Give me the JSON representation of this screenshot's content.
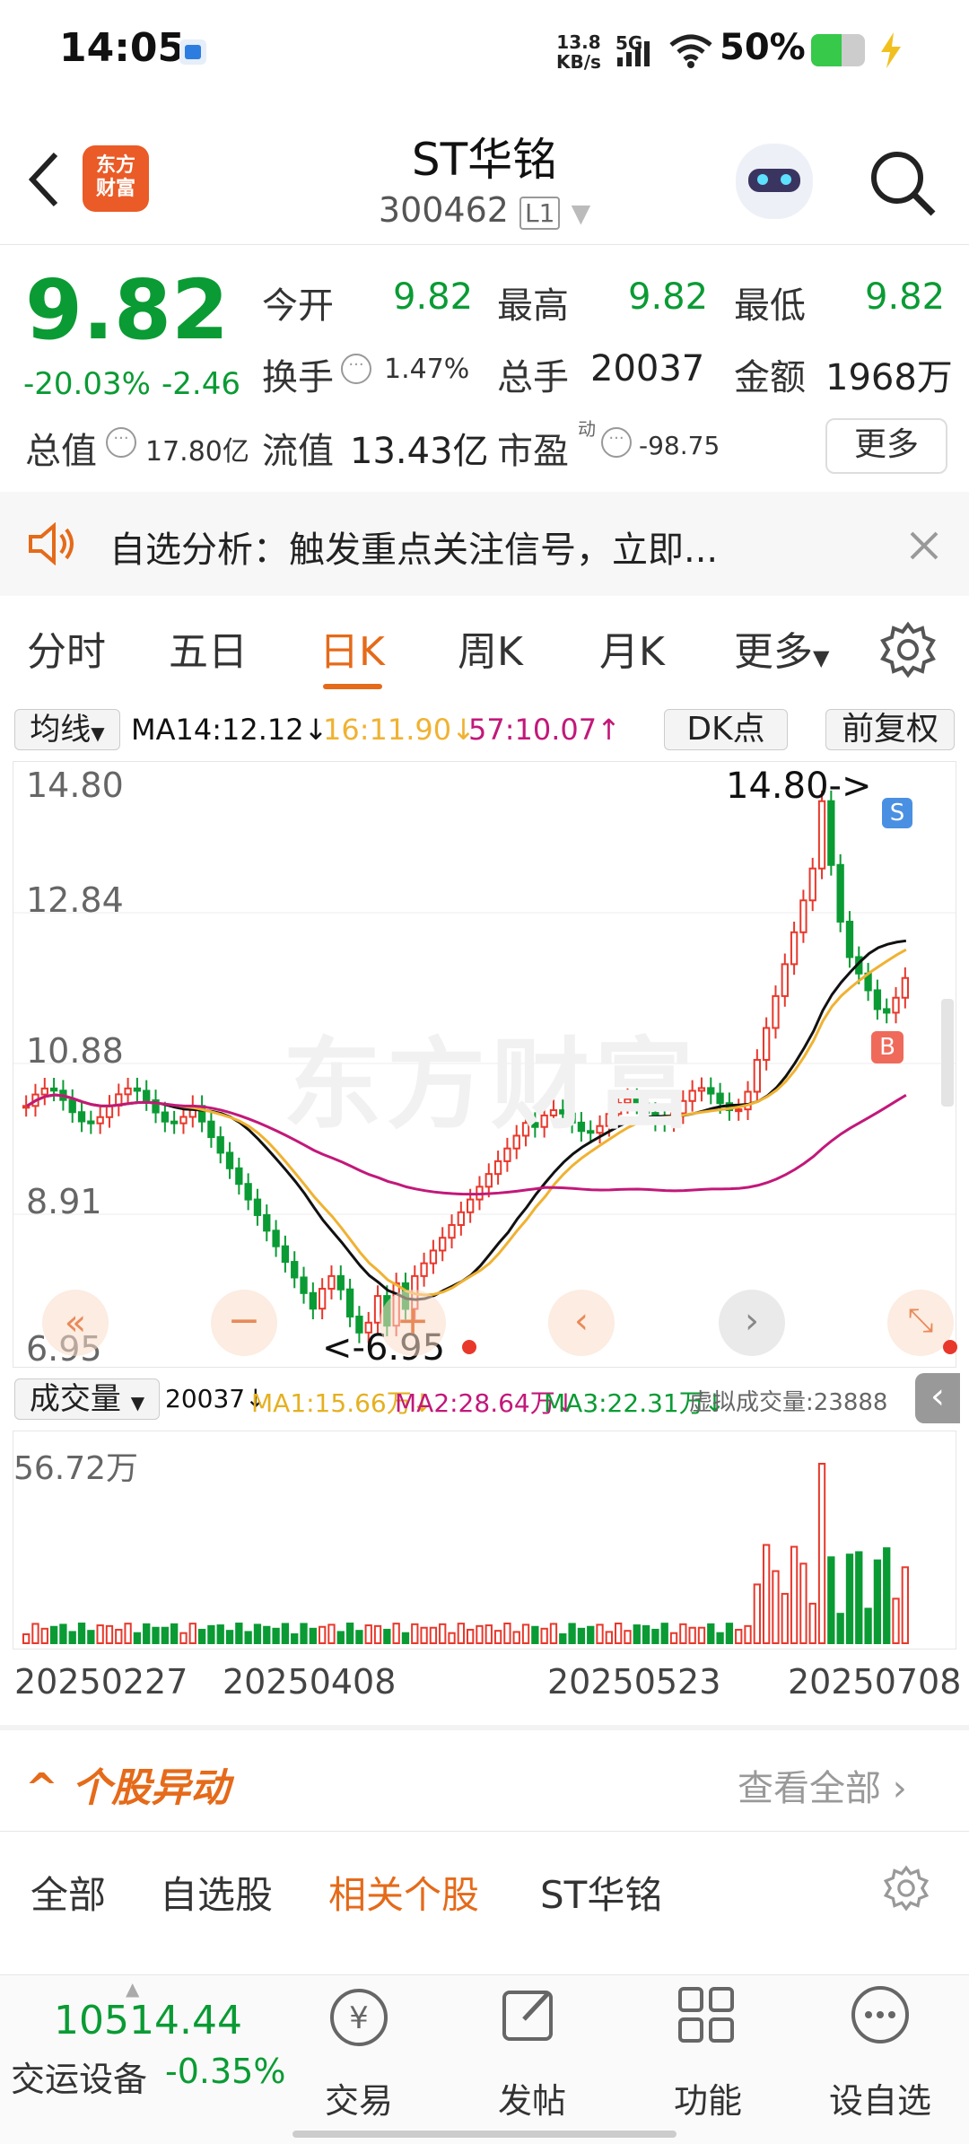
{
  "status_bar": {
    "time": "14:05",
    "net_speed_top": "13.8",
    "net_speed_bottom": "KB/s",
    "signal": "5G",
    "battery": "50%"
  },
  "header": {
    "title": "ST华铭",
    "code": "300462",
    "level": "L1",
    "logo_line1": "东方",
    "logo_line2": "财富"
  },
  "quote": {
    "price": "9.82",
    "change_pct": "-20.03%",
    "change": "-2.46",
    "open_label": "今开",
    "open": "9.82",
    "high_label": "最高",
    "high": "9.82",
    "low_label": "最低",
    "low": "9.82",
    "turnover_label": "换手",
    "turnover": "1.47%",
    "volume_label": "总手",
    "volume": "20037",
    "amount_label": "金额",
    "amount": "1968万",
    "mcap_label": "总值",
    "mcap": "17.80亿",
    "float_label": "流值",
    "float": "13.43亿",
    "pe_label": "市盈",
    "pe_sup": "动",
    "pe": "-98.75",
    "more_button": "更多"
  },
  "notice": {
    "text": "自选分析：触发重点关注信号，立即..."
  },
  "tabs": [
    "分时",
    "五日",
    "日K",
    "周K",
    "月K",
    "更多"
  ],
  "active_tab_index": 2,
  "kline": {
    "ma_selector": "均线",
    "ma14": "MA14:12.12",
    "ma16": "16:11.90",
    "ma57": "57:10.07",
    "dk_button": "DK点",
    "adjust_button": "前复权",
    "y_ticks": [
      "14.80",
      "12.84",
      "10.88",
      "8.91",
      "6.95"
    ],
    "high_marker": "14.80->",
    "low_marker": "<-6.95",
    "watermark": "东方财富",
    "s_badge": "S",
    "b_badge": "B"
  },
  "volume": {
    "selector": "成交量",
    "vol": "20037",
    "ma1": "MA1:15.66万",
    "ma2": "MA2:28.64万",
    "ma3": "MA3:22.31万",
    "virtual": "虚拟成交量:23888",
    "max_label": "56.72万",
    "dates": [
      "20250227",
      "20250408",
      "20250523",
      "20250708"
    ]
  },
  "movers": {
    "title": "个股异动",
    "view_all": "查看全部",
    "tabs": [
      "全部",
      "自选股",
      "相关个股",
      "ST华铭"
    ],
    "active_index": 2
  },
  "bottom": {
    "index_value": "10514.44",
    "index_name": "交运设备",
    "index_change": "-0.35%",
    "nav": [
      "交易",
      "发帖",
      "功能",
      "设自选"
    ]
  },
  "colors": {
    "up": "#e8382c",
    "down": "#0a9b34",
    "accent": "#e56a19",
    "ma14": "#111111",
    "ma16": "#f0b232",
    "ma57": "#c2187a"
  }
}
